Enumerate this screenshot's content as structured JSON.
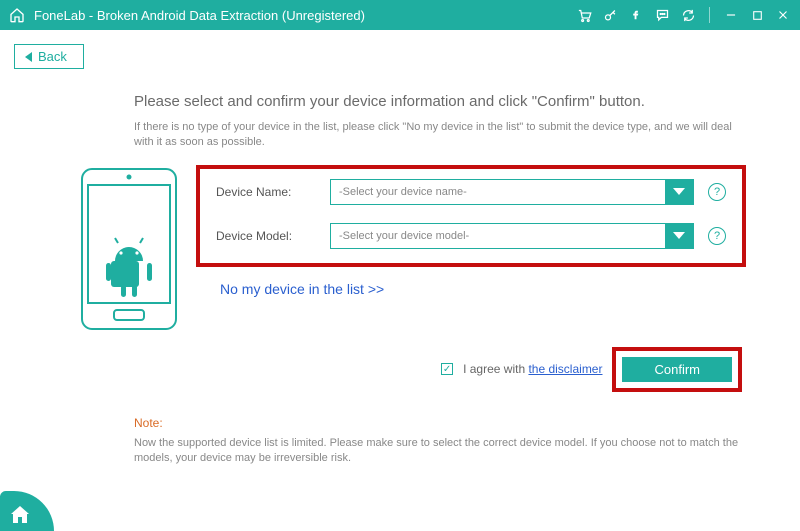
{
  "titlebar": {
    "title": "FoneLab - Broken Android Data Extraction (Unregistered)"
  },
  "back": {
    "label": "Back"
  },
  "page": {
    "heading": "Please select and confirm your device information and click \"Confirm\" button.",
    "sub": "If there is no type of your device in the list, please click \"No my device in the list\" to submit the device type, and we will deal with it as soon as possible."
  },
  "form": {
    "name_label": "Device Name:",
    "name_placeholder": "-Select your device name-",
    "model_label": "Device Model:",
    "model_placeholder": "-Select your device model-",
    "no_list": "No my device in the list >>"
  },
  "agree": {
    "prefix": "I agree with ",
    "link": "the disclaimer",
    "checked": true
  },
  "confirm": {
    "label": "Confirm"
  },
  "note": {
    "head": "Note:",
    "body": "Now the supported device list is limited. Please make sure to select the correct device model. If you choose not to match the models, your device may be irreversible risk."
  },
  "colors": {
    "accent": "#1faea0",
    "highlight": "#c40e0e"
  }
}
